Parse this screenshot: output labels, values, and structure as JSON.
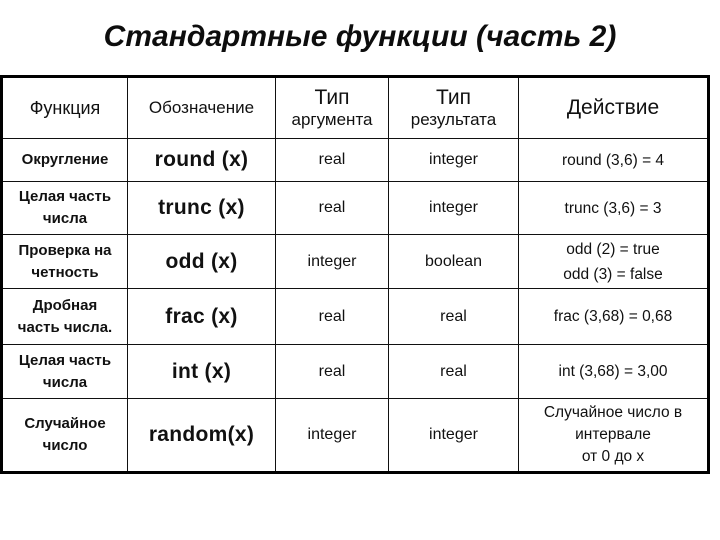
{
  "title": "Стандартные функции (часть 2)",
  "table": {
    "headers": {
      "function": "Функция",
      "notation": "Обозначение",
      "arg_type_line1": "Тип",
      "arg_type_line2": "аргумента",
      "result_type_line1": "Тип",
      "result_type_line2": "результата",
      "action": "Действие"
    },
    "rows": [
      {
        "function_lines": [
          "Округление"
        ],
        "notation": "round (x)",
        "arg_type": "real",
        "result_type": "integer",
        "action_lines": [
          "round (3,6) = 4"
        ]
      },
      {
        "function_lines": [
          "Целая часть",
          "числа"
        ],
        "notation": "trunc (x)",
        "arg_type": "real",
        "result_type": "integer",
        "action_lines": [
          "trunc (3,6) = 3"
        ]
      },
      {
        "function_lines": [
          "Проверка на",
          "четность"
        ],
        "notation": "odd (x)",
        "arg_type": "integer",
        "result_type": "boolean",
        "action_lines": [
          "odd (2) = true",
          "odd (3) = false"
        ]
      },
      {
        "function_lines": [
          "Дробная",
          "часть числа."
        ],
        "notation": "frac (x)",
        "arg_type": "real",
        "result_type": "real",
        "action_lines": [
          "frac (3,68) = 0,68"
        ]
      },
      {
        "function_lines": [
          "Целая часть",
          "числа"
        ],
        "notation": "int (x)",
        "arg_type": "real",
        "result_type": "real",
        "action_lines": [
          "int (3,68) = 3,00"
        ]
      },
      {
        "function_lines": [
          "Случайное",
          "число"
        ],
        "notation": "random(x)",
        "arg_type": "integer",
        "result_type": "integer",
        "action_lines": [
          "Случайное число в",
          "интервале",
          "от 0 до x"
        ]
      }
    ]
  }
}
